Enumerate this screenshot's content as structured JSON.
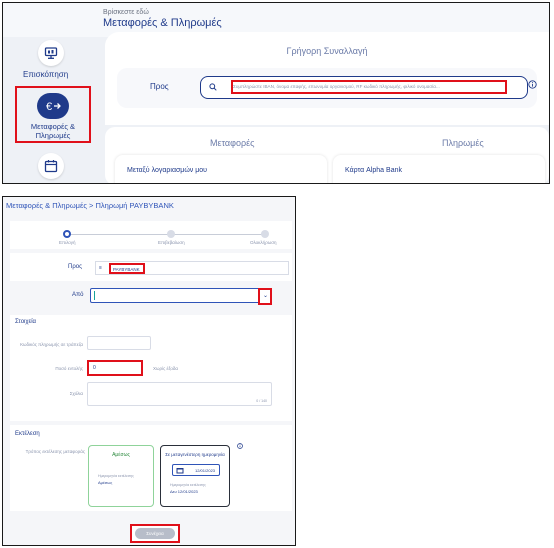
{
  "top_panel": {
    "breadcrumb_hint": "Βρίσκεστε εδώ",
    "page_title": "Μεταφορές & Πληρωμές",
    "sidebar": {
      "overview_label": "Επισκόπηση",
      "transfers_label": "Μεταφορές & Πληρωμές"
    },
    "quick_transaction": {
      "title": "Γρήγορη Συναλλαγή",
      "to_label": "Προς",
      "search_placeholder": "Συμπληρώστε IBAN, όνομα επαφής, επωνυμία οργανισμού, RF κωδικό πληρωμής, φιλικό ονομασία..."
    },
    "tabs": {
      "transfers": "Μεταφορές",
      "payments": "Πληρωμές"
    },
    "cards": {
      "between_accounts": "Μεταξύ λογαριασμών μου",
      "alpha_card": "Κάρτα Alpha Bank"
    }
  },
  "form": {
    "breadcrumb": "Μεταφορές & Πληρωμές > Πληρωμή PAYBYBANK",
    "steps": [
      "Επιλογή",
      "Επιβεβαίωση",
      "Ολοκλήρωση"
    ],
    "to_label": "Προς",
    "to_value": "PAYBYBANK",
    "from_label": "Από",
    "details": {
      "title": "Στοιχεία",
      "payment_code_label": "Κωδικός πληρωμής σε τράπεζα",
      "amount_label": "Ποσό εντολής",
      "amount_value": "0",
      "fees_label": "Χωρίς έξοδα",
      "comments_label": "Σχόλια",
      "counter": "0 / 140"
    },
    "execution": {
      "title": "Εκτέλεση",
      "mode_label": "Τρόπος εκτέλεσης μεταφοράς",
      "now": {
        "title": "Αμέσως",
        "sub_label": "Ημερομηνία εκτέλεσης",
        "sub_value": "Αμέσως"
      },
      "later": {
        "title": "Σε μεταγενέστερη ημερομηνία",
        "date_value": "12/01/2023",
        "sub_label": "Ημερομηνία εκτέλεσης",
        "sub_value": "Δευ 12/01/2023"
      }
    },
    "continue_button": "Συνέχεια"
  },
  "colors": {
    "brand": "#1f3a8a",
    "highlight": "#e0101a",
    "success": "#2b8a3e"
  }
}
